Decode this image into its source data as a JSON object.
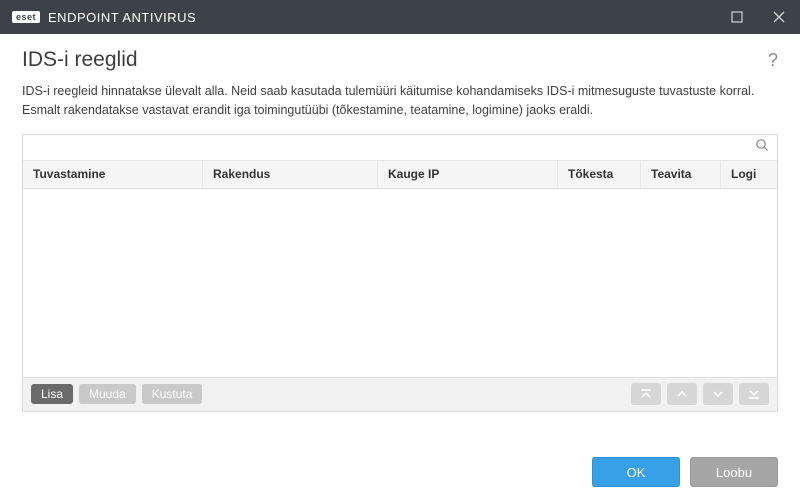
{
  "titlebar": {
    "brand": "eset",
    "app": "ENDPOINT ANTIVIRUS"
  },
  "page": {
    "title": "IDS-i reeglid",
    "help": "?",
    "description": "IDS-i reegleid hinnatakse ülevalt alla. Neid saab kasutada tulemüüri käitumise kohandamiseks IDS-i mitmesuguste tuvastuste korral. Esmalt rakendatakse vastavat erandit iga toimingutüübi (tõkestamine, teatamine, logimine) jaoks eraldi."
  },
  "search": {
    "placeholder": ""
  },
  "columns": {
    "detect": "Tuvastamine",
    "app": "Rakendus",
    "ip": "Kauge IP",
    "block": "Tõkesta",
    "notify": "Teavita",
    "log": "Logi"
  },
  "rows": [],
  "toolbar": {
    "add": "Lisa",
    "edit": "Muuda",
    "delete": "Kustuta"
  },
  "footer": {
    "ok": "OK",
    "cancel": "Loobu"
  }
}
